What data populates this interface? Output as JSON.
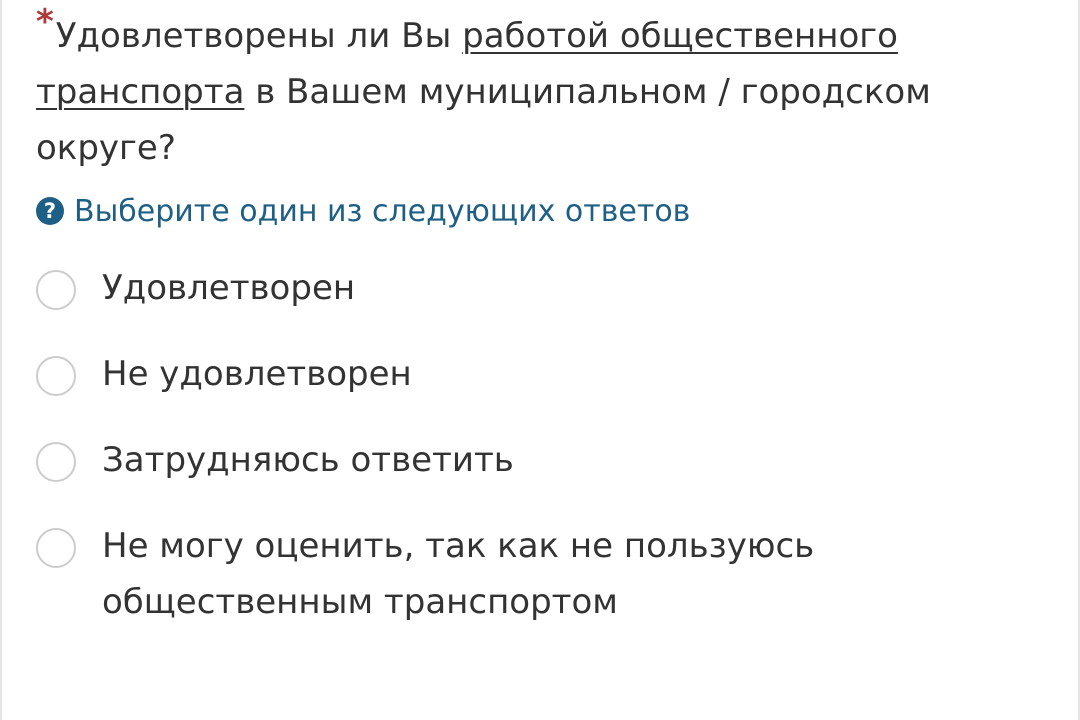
{
  "question": {
    "required_mark": "*",
    "text_before": "Удовлетворены ли Вы ",
    "link_text": "работой общественного транспорта",
    "text_after": " в Вашем муниципальном / городском округе?"
  },
  "hint": {
    "icon": "question-circle-icon",
    "icon_glyph": "?",
    "text": "Выберите один из следующих ответов"
  },
  "options": [
    {
      "label": "Удовлетворен",
      "selected": false
    },
    {
      "label": "Не удовлетворен",
      "selected": false
    },
    {
      "label": "Затрудняюсь ответить",
      "selected": false
    },
    {
      "label": "Не могу оценить, так как не пользуюсь общественным транспортом",
      "selected": false
    }
  ],
  "colors": {
    "required": "#b03a3a",
    "hint": "#1e5f86",
    "text": "#333333",
    "radio_border": "#cccccc"
  }
}
